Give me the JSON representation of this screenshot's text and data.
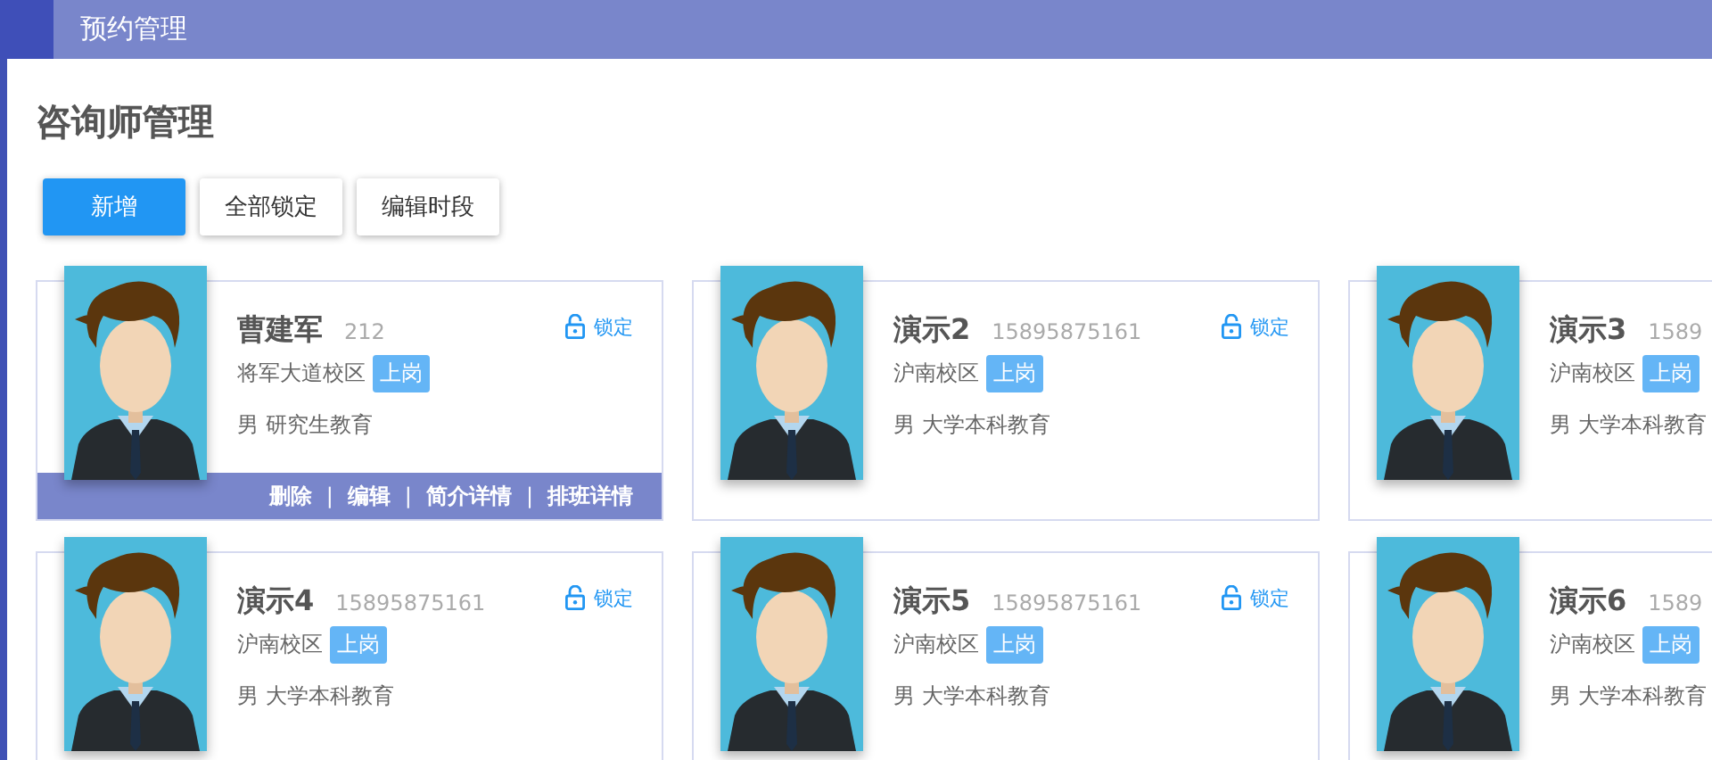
{
  "header": {
    "title": "预约管理"
  },
  "page_title": "咨询师管理",
  "toolbar": [
    {
      "label": "新增",
      "kind": "primary"
    },
    {
      "label": "全部锁定",
      "kind": "default"
    },
    {
      "label": "编辑时段",
      "kind": "default"
    }
  ],
  "action_separator": "|",
  "cards": [
    {
      "name": "曹建军",
      "phone": "212",
      "campus": "将军大道校区",
      "status": "上岗",
      "gender": "男",
      "education": "研究生教育",
      "lock_label": "锁定",
      "locked": false,
      "actions": [
        "删除",
        "编辑",
        "简介详情",
        "排班详情"
      ]
    },
    {
      "name": "演示2",
      "phone": "15895875161",
      "campus": "沪南校区",
      "status": "上岗",
      "gender": "男",
      "education": "大学本科教育",
      "lock_label": "锁定",
      "locked": false
    },
    {
      "name": "演示3",
      "phone": "1589",
      "campus": "沪南校区",
      "status": "上岗",
      "gender": "男",
      "education": "大学本科教育"
    },
    {
      "name": "演示4",
      "phone": "15895875161",
      "campus": "沪南校区",
      "status": "上岗",
      "gender": "男",
      "education": "大学本科教育",
      "lock_label": "锁定",
      "locked": false
    },
    {
      "name": "演示5",
      "phone": "15895875161",
      "campus": "沪南校区",
      "status": "上岗",
      "gender": "男",
      "education": "大学本科教育",
      "lock_label": "锁定",
      "locked": false
    },
    {
      "name": "演示6",
      "phone": "1589",
      "campus": "沪南校区",
      "status": "上岗",
      "gender": "男",
      "education": "大学本科教育"
    }
  ]
}
